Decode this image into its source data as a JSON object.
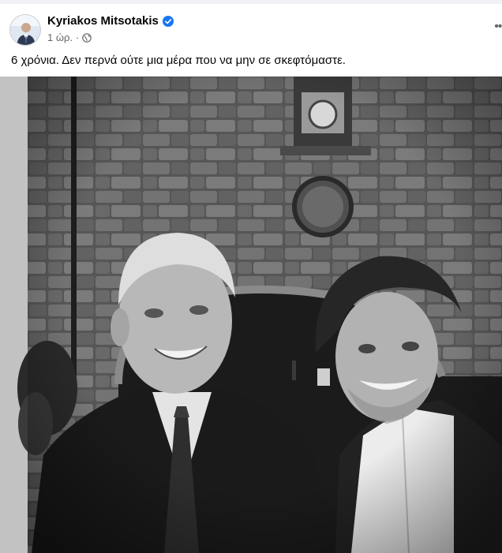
{
  "post": {
    "author": "Kyriakos Mitsotakis",
    "time": "1 ώρ.",
    "text": "6 χρόνια. Δεν περνά ούτε μια μέρα που να μην σε σκεφτόμαστε."
  },
  "icons": {
    "verified": "verified-badge-icon",
    "audience": "globe-icon",
    "more": "more-options-icon"
  },
  "colors": {
    "verified": "#1877f2",
    "secondary_text": "#65676b",
    "background": "#f0f2f5"
  }
}
